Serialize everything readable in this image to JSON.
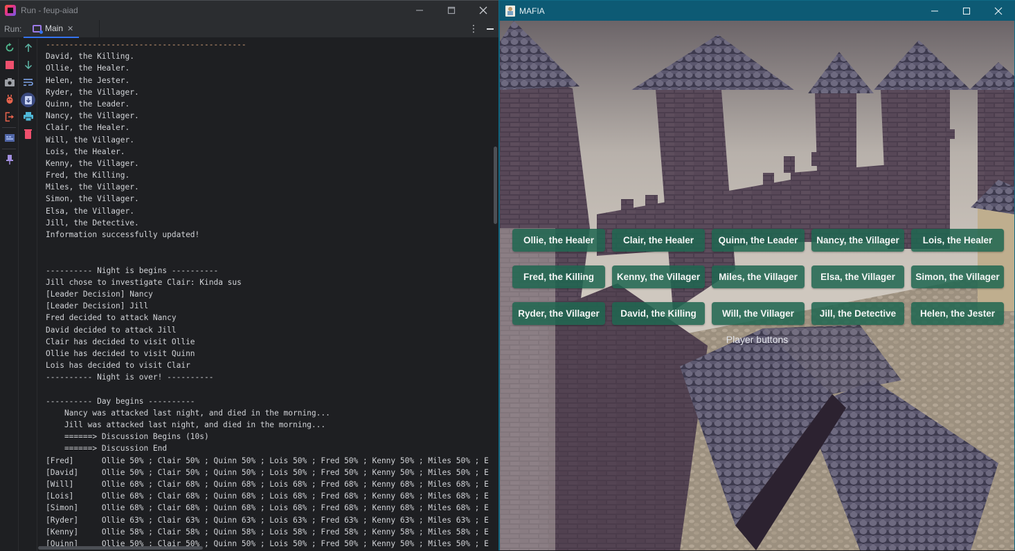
{
  "ide": {
    "window_title": "Run - feup-aiad",
    "toolwindow_label": "Run:",
    "tab": {
      "label": "Main",
      "close_glyph": "✕"
    },
    "more_glyph": "⋮",
    "left_toolbar": [
      "rerun-icon",
      "stop-icon",
      "screenshot-icon",
      "debug-attach-icon",
      "exit-icon",
      "layout-icon",
      "pin-icon"
    ],
    "right_toolbar": [
      "scroll-up-icon",
      "scroll-down-icon",
      "soft-wrap-icon",
      "scroll-to-end-icon",
      "print-icon",
      "clear-all-icon"
    ],
    "console": {
      "lines": [
        {
          "text": "-------------------------------------------",
          "kind": "sep"
        },
        {
          "text": "David, the Killing."
        },
        {
          "text": "Ollie, the Healer."
        },
        {
          "text": "Helen, the Jester."
        },
        {
          "text": "Ryder, the Villager."
        },
        {
          "text": "Quinn, the Leader."
        },
        {
          "text": "Nancy, the Villager."
        },
        {
          "text": "Clair, the Healer."
        },
        {
          "text": "Will, the Villager."
        },
        {
          "text": "Lois, the Healer."
        },
        {
          "text": "Kenny, the Villager."
        },
        {
          "text": "Fred, the Killing."
        },
        {
          "text": "Miles, the Villager."
        },
        {
          "text": "Simon, the Villager."
        },
        {
          "text": "Elsa, the Villager."
        },
        {
          "text": "Jill, the Detective."
        },
        {
          "text": "Information successfully updated!"
        },
        {
          "text": ""
        },
        {
          "text": ""
        },
        {
          "text": "---------- Night is begins ----------"
        },
        {
          "text": "Jill chose to investigate Clair: Kinda sus"
        },
        {
          "text": "[Leader Decision] Nancy"
        },
        {
          "text": "[Leader Decision] Jill"
        },
        {
          "text": "Fred decided to attack Nancy"
        },
        {
          "text": "David decided to attack Jill"
        },
        {
          "text": "Clair has decided to visit Ollie"
        },
        {
          "text": "Ollie has decided to visit Quinn"
        },
        {
          "text": "Lois has decided to visit Clair"
        },
        {
          "text": "---------- Night is over! ----------"
        },
        {
          "text": ""
        },
        {
          "text": "---------- Day begins ----------"
        },
        {
          "text": "    Nancy was attacked last night, and died in the morning..."
        },
        {
          "text": "    Jill was attacked last night, and died in the morning..."
        },
        {
          "text": "    ======> Discussion Begins (10s)"
        },
        {
          "text": "    ======> Discussion End"
        },
        {
          "text": "[Fred]      Ollie 50% ; Clair 50% ; Quinn 50% ; Lois 50% ; Fred 50% ; Kenny 50% ; Miles 50% ; E"
        },
        {
          "text": "[David]     Ollie 50% ; Clair 50% ; Quinn 50% ; Lois 50% ; Fred 50% ; Kenny 50% ; Miles 50% ; E"
        },
        {
          "text": "[Will]      Ollie 68% ; Clair 68% ; Quinn 68% ; Lois 68% ; Fred 68% ; Kenny 68% ; Miles 68% ; E"
        },
        {
          "text": "[Lois]      Ollie 68% ; Clair 68% ; Quinn 68% ; Lois 68% ; Fred 68% ; Kenny 68% ; Miles 68% ; E"
        },
        {
          "text": "[Simon]     Ollie 68% ; Clair 68% ; Quinn 68% ; Lois 68% ; Fred 68% ; Kenny 68% ; Miles 68% ; E"
        },
        {
          "text": "[Ryder]     Ollie 63% ; Clair 63% ; Quinn 63% ; Lois 63% ; Fred 63% ; Kenny 63% ; Miles 63% ; E"
        },
        {
          "text": "[Kenny]     Ollie 58% ; Clair 58% ; Quinn 58% ; Lois 58% ; Fred 58% ; Kenny 58% ; Miles 58% ; E"
        },
        {
          "text": "[Quinn]     Ollie 50% ; Clair 50% ; Quinn 50% ; Lois 50% ; Fred 50% ; Kenny 50% ; Miles 50% ; E"
        }
      ]
    }
  },
  "mafia": {
    "window_title": "MAFIA",
    "player_buttons": [
      "Ollie, the Healer",
      "Clair, the Healer",
      "Quinn, the Leader",
      "Nancy, the Villager",
      "Lois, the Healer",
      "Fred, the Killing",
      "Kenny, the Villager",
      "Miles, the Villager",
      "Elsa, the Villager",
      "Simon, the Villager",
      "Ryder, the Villager",
      "David, the Killing",
      "Will, the Villager",
      "Jill, the Detective",
      "Helen, the Jester"
    ],
    "player_buttons_label": "Player buttons"
  },
  "colors": {
    "ide_bg": "#1e1f22",
    "ide_chrome": "#2b2d30",
    "tab_accent": "#3574f0",
    "console_text": "#d1d3d7",
    "console_separator": "#d5a27a",
    "mafia_titlebar": "#0d5a74",
    "player_button": "#206650"
  }
}
